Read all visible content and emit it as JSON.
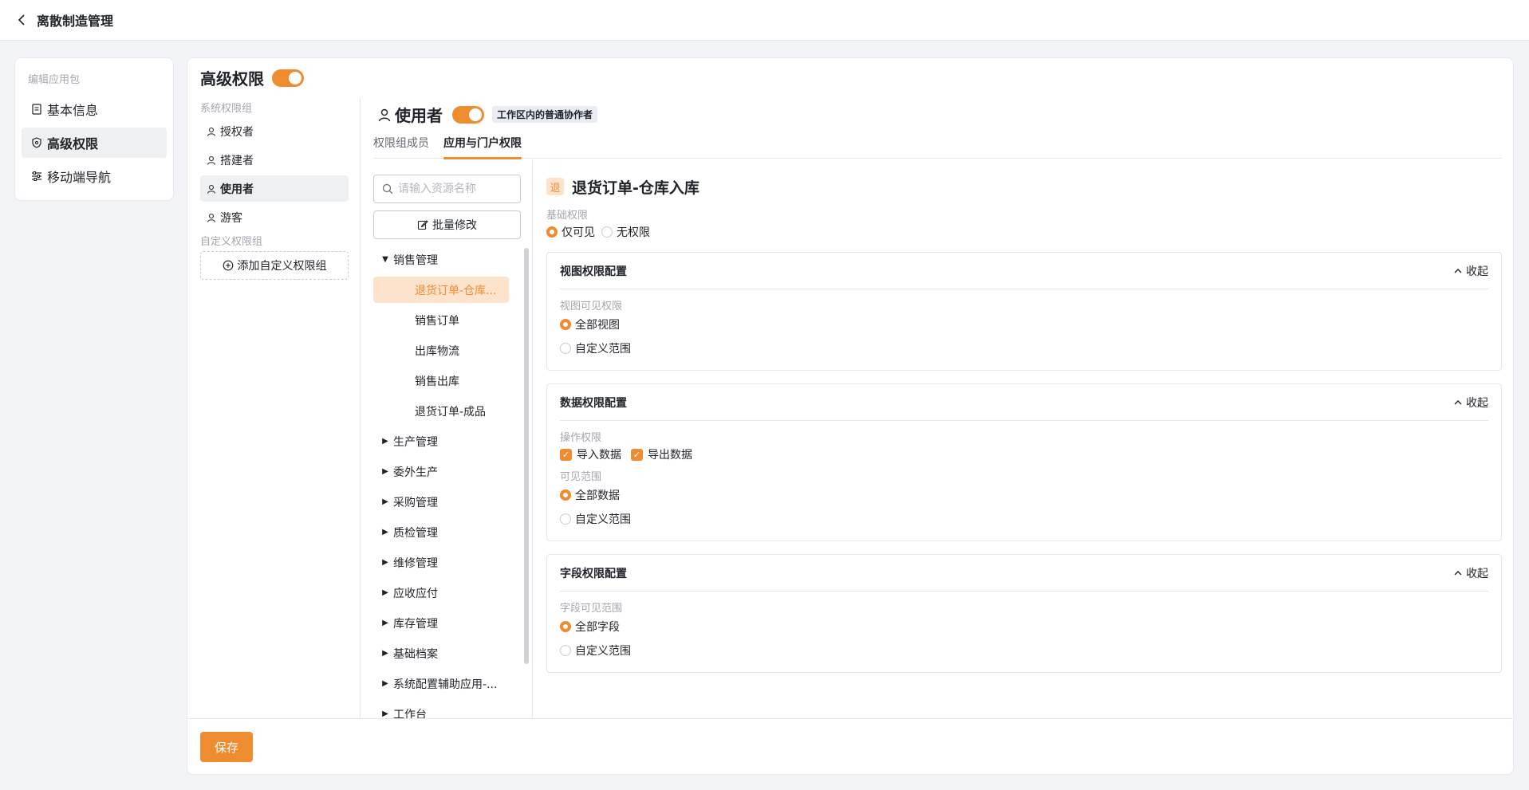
{
  "header": {
    "title": "离散制造管理"
  },
  "left_nav": {
    "caption": "编辑应用包",
    "items": [
      {
        "label": "基本信息",
        "icon": "document-icon",
        "active": false
      },
      {
        "label": "高级权限",
        "icon": "shield-icon",
        "active": true
      },
      {
        "label": "移动端导航",
        "icon": "sliders-icon",
        "active": false
      }
    ]
  },
  "main": {
    "title": "高级权限",
    "toggle_on": true,
    "system_groups_caption": "系统权限组",
    "system_groups": [
      {
        "label": "授权者"
      },
      {
        "label": "搭建者"
      },
      {
        "label": "使用者",
        "active": true
      },
      {
        "label": "游客"
      }
    ],
    "custom_groups_caption": "自定义权限组",
    "add_custom_group": "添加自定义权限组"
  },
  "role": {
    "name": "使用者",
    "tag": "工作区内的普通协作者",
    "toggle_on": true
  },
  "tabs": [
    {
      "label": "权限组成员",
      "active": false
    },
    {
      "label": "应用与门户权限",
      "active": true
    }
  ],
  "resources": {
    "search_placeholder": "请输入资源名称",
    "batch_edit": "批量修改",
    "tree": [
      {
        "label": "销售管理",
        "expanded": true,
        "children": [
          {
            "label": "退货订单-仓库...",
            "active": true
          },
          {
            "label": "销售订单"
          },
          {
            "label": "出库物流"
          },
          {
            "label": "销售出库"
          },
          {
            "label": "退货订单-成品"
          }
        ]
      },
      {
        "label": "生产管理"
      },
      {
        "label": "委外生产"
      },
      {
        "label": "采购管理"
      },
      {
        "label": "质检管理"
      },
      {
        "label": "维修管理"
      },
      {
        "label": "应收应付"
      },
      {
        "label": "库存管理"
      },
      {
        "label": "基础档案"
      },
      {
        "label": "系统配置辅助应用-..."
      },
      {
        "label": "工作台"
      }
    ]
  },
  "detail": {
    "badge": "退",
    "title": "退货订单-仓库入库",
    "basic": {
      "caption": "基础权限",
      "options": [
        "仅可见",
        "无权限"
      ],
      "selected": "仅可见"
    },
    "view_panel": {
      "title": "视图权限配置",
      "collapse": "收起",
      "caption": "视图可见权限",
      "options": [
        "全部视图",
        "自定义范围"
      ],
      "selected": "全部视图"
    },
    "data_panel": {
      "title": "数据权限配置",
      "collapse": "收起",
      "ops_caption": "操作权限",
      "ops": [
        {
          "label": "导入数据",
          "checked": true
        },
        {
          "label": "导出数据",
          "checked": true
        }
      ],
      "scope_caption": "可见范围",
      "options": [
        "全部数据",
        "自定义范围"
      ],
      "selected": "全部数据"
    },
    "field_panel": {
      "title": "字段权限配置",
      "collapse": "收起",
      "caption": "字段可见范围",
      "options": [
        "全部字段",
        "自定义范围"
      ],
      "selected": "全部字段"
    }
  },
  "footer": {
    "save": "保存"
  },
  "colors": {
    "accent": "#ef8c30",
    "accent_light": "#fde3cc",
    "tag_bg": "#e9ecf5"
  }
}
